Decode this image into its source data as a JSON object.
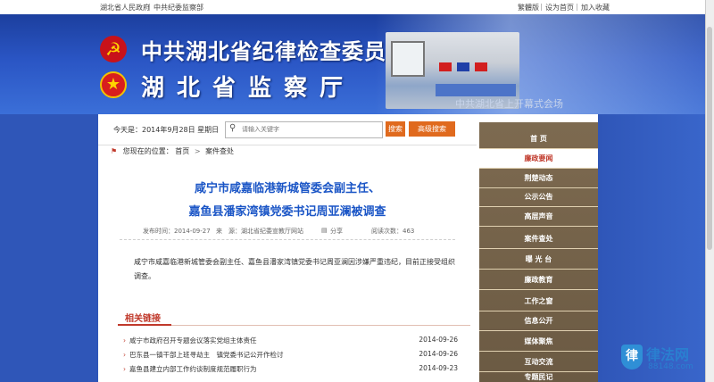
{
  "topbar": {
    "left_links": [
      "湖北省人民政府",
      "中共纪委监察部"
    ],
    "right_links": [
      "繁體版",
      "设为首页",
      "加入收藏"
    ]
  },
  "header": {
    "title1": "中共湖北省纪律检查委员会",
    "title2": "湖北省监察厅",
    "meeting_text": "中共湖北省上开幕式会场"
  },
  "search": {
    "date": "今天是：2014年9月28日 星期日",
    "placeholder": "请输入关键字",
    "search_button": "搜索",
    "advanced_button": "高级搜索"
  },
  "breadcrumb": {
    "prefix": "您现在的位置：",
    "items": [
      "首页",
      "案件查处"
    ]
  },
  "article": {
    "title_line1": "咸宁市咸嘉临港新城管委会副主任、",
    "title_line2": "嘉鱼县潘家湾镇党委书记周亚澜被调查",
    "publish_time": "发布时间：2014-09-27",
    "source": "来　源：湖北省纪委宣教厅网站",
    "share": "分享",
    "views": "阅读次数：463",
    "body": "咸宁市咸嘉临港新城管委会副主任、嘉鱼县潘家湾镇党委书记周亚澜因涉嫌严重违纪，目前正接受组织调查。"
  },
  "related": {
    "label": "相关链接",
    "items": [
      {
        "title": "咸宁市政府召开专题会议落实党组主体责任",
        "date": "2014-09-26"
      },
      {
        "title": "巴东县一镇干部上班寻劫主　镇党委书记公开作检讨",
        "date": "2014-09-26"
      },
      {
        "title": "嘉鱼县建立内部工作约谈制度规范履职行为",
        "date": "2014-09-23"
      }
    ]
  },
  "sidebar": {
    "items": [
      "首 页",
      "廉政要闻",
      "荆楚动态",
      "公示公告",
      "高层声音",
      "案件查处",
      "曝 光 台",
      "廉政教育",
      "工作之窗",
      "信息公开",
      "媒体聚焦",
      "互动交流",
      "专题民记"
    ],
    "active_index": 1
  },
  "watermark": {
    "text": "律法网",
    "sub": "88148.com"
  },
  "colors": {
    "accent": "#e06a1e",
    "title_blue": "#1a55c6",
    "nav_brown": "#7d6a50",
    "related_red": "#c0392b"
  }
}
